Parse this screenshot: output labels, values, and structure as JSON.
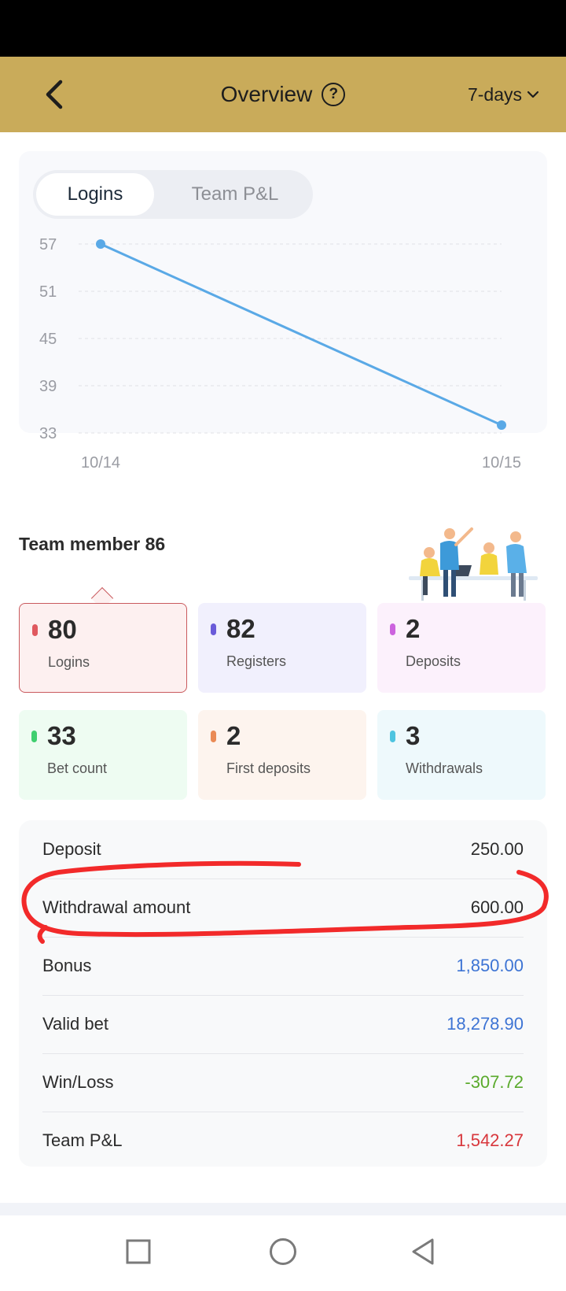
{
  "header": {
    "title": "Overview",
    "range": "7-days"
  },
  "chart_tabs": [
    {
      "label": "Logins",
      "active": true
    },
    {
      "label": "Team P&L",
      "active": false
    }
  ],
  "chart_data": {
    "type": "line",
    "x": [
      "10/14",
      "10/15"
    ],
    "series": [
      {
        "values": [
          57,
          34
        ]
      }
    ],
    "yticks": [
      57,
      51,
      45,
      39,
      33
    ],
    "ylim": [
      33,
      57
    ],
    "grid": true,
    "line_color": "#5aa9e6"
  },
  "team": {
    "title": "Team member 86"
  },
  "stats": [
    {
      "value": "80",
      "label": "Logins",
      "bg": "#fdf0f0",
      "dot": "#e0595f",
      "selected": true
    },
    {
      "value": "82",
      "label": "Registers",
      "bg": "#f1f0fd",
      "dot": "#6a5bd9",
      "selected": false
    },
    {
      "value": "2",
      "label": "Deposits",
      "bg": "#fcf1fc",
      "dot": "#cc63de",
      "selected": false
    },
    {
      "value": "33",
      "label": "Bet count",
      "bg": "#eefcf2",
      "dot": "#3fcf6f",
      "selected": false
    },
    {
      "value": "2",
      "label": "First deposits",
      "bg": "#fdf4ee",
      "dot": "#ea8a55",
      "selected": false
    },
    {
      "value": "3",
      "label": "Withdrawals",
      "bg": "#eef9fc",
      "dot": "#4ec4e0",
      "selected": false
    }
  ],
  "summary": [
    {
      "label": "Deposit",
      "value": "250.00",
      "color": "#2b2b2b"
    },
    {
      "label": "Withdrawal amount",
      "value": "600.00",
      "color": "#2b2b2b"
    },
    {
      "label": "Bonus",
      "value": "1,850.00",
      "color": "#3d74d4"
    },
    {
      "label": "Valid bet",
      "value": "18,278.90",
      "color": "#3d74d4"
    },
    {
      "label": "Win/Loss",
      "value": "-307.72",
      "color": "#5aaa2c"
    },
    {
      "label": "Team P&L",
      "value": "1,542.27",
      "color": "#d8373c"
    }
  ],
  "annotation_color": "#f22a2a"
}
